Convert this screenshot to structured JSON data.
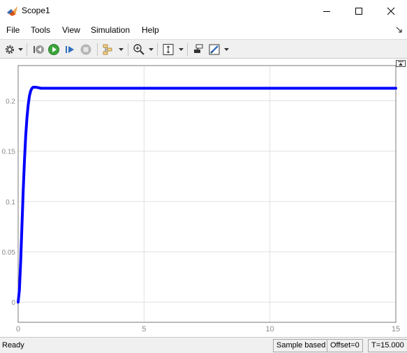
{
  "window": {
    "title": "Scope1"
  },
  "menu": {
    "items": [
      "File",
      "Tools",
      "View",
      "Simulation",
      "Help"
    ]
  },
  "toolbar": {
    "icons": [
      "gear-icon",
      "step-back-icon",
      "run-icon",
      "step-forward-icon",
      "stop-icon",
      "signal-selector-icon",
      "zoom-icon",
      "axes-scaling-icon",
      "highlight-block-icon",
      "style-icon"
    ]
  },
  "colors": {
    "signal": "#0000ff",
    "grid": "#e0e0e0",
    "axis_text": "#8a8a8a",
    "run_green": "#3aa53a"
  },
  "chart_data": {
    "type": "line",
    "title": "",
    "xlabel": "",
    "ylabel": "",
    "xlim": [
      0,
      15
    ],
    "ylim": [
      -0.02,
      0.235
    ],
    "xticks": [
      0,
      5,
      10,
      15
    ],
    "yticks": [
      0,
      0.05,
      0.1,
      0.15,
      0.2
    ],
    "ytick_labels": [
      "0",
      "0.05",
      "0.1",
      "0.15",
      "0.2"
    ],
    "xtick_labels": [
      "0",
      "5",
      "10",
      "15"
    ],
    "grid": true,
    "series": [
      {
        "x": [
          0,
          0.05,
          0.1,
          0.15,
          0.2,
          0.25,
          0.3,
          0.35,
          0.4,
          0.45,
          0.5,
          0.55,
          0.6,
          0.7,
          0.8,
          0.9,
          1.0,
          2.0,
          5.0,
          10.0,
          15.0
        ],
        "values": [
          0,
          0.012,
          0.04,
          0.075,
          0.11,
          0.14,
          0.165,
          0.183,
          0.196,
          0.205,
          0.21,
          0.2125,
          0.2135,
          0.2135,
          0.213,
          0.2125,
          0.2125,
          0.2125,
          0.2125,
          0.2125,
          0.2125
        ]
      }
    ]
  },
  "status": {
    "ready": "Ready",
    "sample_based": "Sample based",
    "offset": "Offset=0",
    "time": "T=15.000"
  }
}
